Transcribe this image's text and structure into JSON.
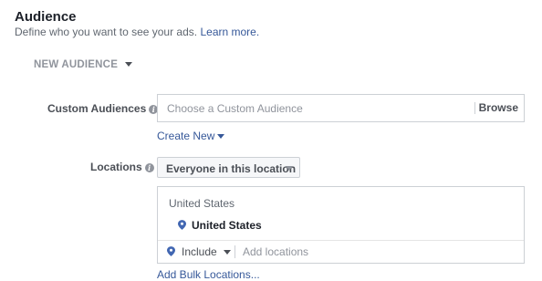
{
  "header": {
    "title": "Audience",
    "subtitle": "Define who you want to see your ads.",
    "learn_more": "Learn more."
  },
  "new_audience": {
    "label": "NEW AUDIENCE",
    "icon": "chevron-down-icon"
  },
  "custom_audiences": {
    "label": "Custom Audiences",
    "placeholder": "Choose a Custom Audience",
    "browse_label": "Browse",
    "create_new_label": "Create New"
  },
  "locations": {
    "label": "Locations",
    "selected_option": "Everyone in this location",
    "country": "United States",
    "selected_location": "United States",
    "include_label": "Include",
    "add_placeholder": "Add locations",
    "bulk_label": "Add Bulk Locations..."
  },
  "colors": {
    "link": "#365899",
    "pin": "#4267b2",
    "border": "#ccd0d5"
  }
}
